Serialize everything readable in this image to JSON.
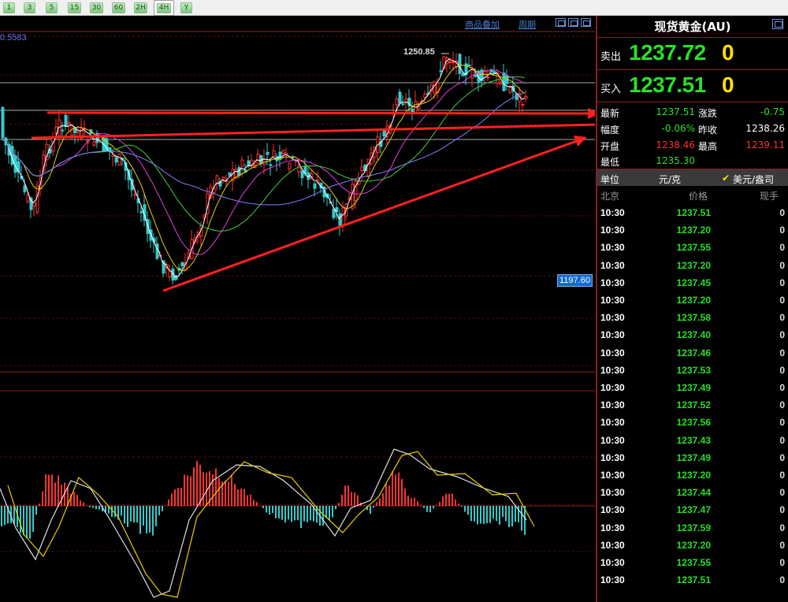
{
  "toolbar": {
    "buttons": [
      "1",
      "3",
      "5",
      "15",
      "30",
      "60",
      "2H",
      "4H",
      "Y"
    ],
    "active_index": 7
  },
  "chart": {
    "links": {
      "overlay": "商品叠加",
      "period": "周期"
    },
    "ma_value": "0.5583",
    "peak_label": "1250.85",
    "price_tag": "1197.60",
    "colors": {
      "up_candle": "#ff3333",
      "down_candle": "#33cccc",
      "ma1": "#ffffff",
      "ma2": "#e8d000",
      "ma3": "#e040e0",
      "ma4": "#40d040",
      "ma5": "#8080ff",
      "trend_arrows": "#ff2020"
    }
  },
  "panel": {
    "title": "现货黄金(AU)",
    "sell": {
      "label": "卖出",
      "price": "1237.72",
      "volume": "0"
    },
    "buy": {
      "label": "买入",
      "price": "1237.51",
      "volume": "0"
    },
    "stats": {
      "latest_label": "最新",
      "latest": "1237.51",
      "change_label": "涨跌",
      "change": "-0.75",
      "pct_label": "幅度",
      "pct": "-0.06%",
      "prev_close_label": "昨收",
      "prev_close": "1238.26",
      "open_label": "开盘",
      "open": "1238.46",
      "high_label": "最高",
      "high": "1239.11",
      "low_label": "最低",
      "low": "1235.30"
    },
    "unit": {
      "label": "单位",
      "cny": "元/克",
      "usd": "美元/盎司",
      "check": "✔"
    },
    "tick_headers": {
      "time": "北京",
      "price": "价格",
      "volume": "现手"
    },
    "ticks": [
      {
        "time": "10:30",
        "price": "1237.51",
        "volume": "0"
      },
      {
        "time": "10:30",
        "price": "1237.20",
        "volume": "0"
      },
      {
        "time": "10:30",
        "price": "1237.55",
        "volume": "0"
      },
      {
        "time": "10:30",
        "price": "1237.20",
        "volume": "0"
      },
      {
        "time": "10:30",
        "price": "1237.45",
        "volume": "0"
      },
      {
        "time": "10:30",
        "price": "1237.20",
        "volume": "0"
      },
      {
        "time": "10:30",
        "price": "1237.58",
        "volume": "0"
      },
      {
        "time": "10:30",
        "price": "1237.40",
        "volume": "0"
      },
      {
        "time": "10:30",
        "price": "1237.46",
        "volume": "0"
      },
      {
        "time": "10:30",
        "price": "1237.53",
        "volume": "0"
      },
      {
        "time": "10:30",
        "price": "1237.49",
        "volume": "0"
      },
      {
        "time": "10:30",
        "price": "1237.52",
        "volume": "0"
      },
      {
        "time": "10:30",
        "price": "1237.56",
        "volume": "0"
      },
      {
        "time": "10:30",
        "price": "1237.43",
        "volume": "0"
      },
      {
        "time": "10:30",
        "price": "1237.49",
        "volume": "0"
      },
      {
        "time": "10:30",
        "price": "1237.20",
        "volume": "0"
      },
      {
        "time": "10:30",
        "price": "1237.44",
        "volume": "0"
      },
      {
        "time": "10:30",
        "price": "1237.47",
        "volume": "0"
      },
      {
        "time": "10:30",
        "price": "1237.59",
        "volume": "0"
      },
      {
        "time": "10:30",
        "price": "1237.20",
        "volume": "0"
      },
      {
        "time": "10:30",
        "price": "1237.55",
        "volume": "0"
      },
      {
        "time": "10:30",
        "price": "1237.51",
        "volume": "0"
      }
    ]
  }
}
